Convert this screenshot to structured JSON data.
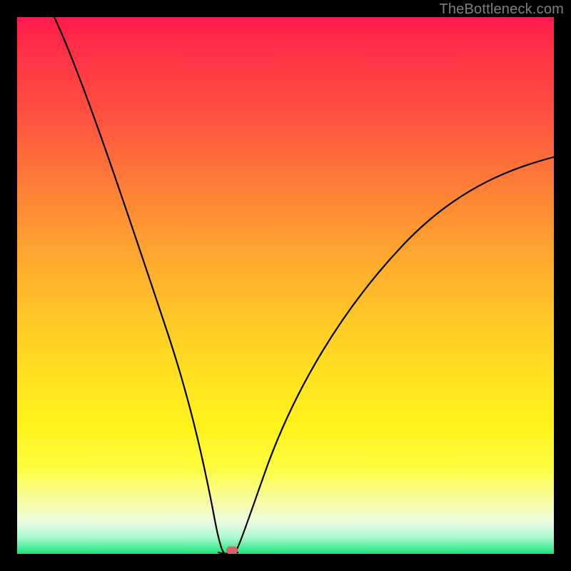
{
  "watermark": "TheBottleneck.com",
  "chart_data": {
    "type": "line",
    "title": "",
    "xlabel": "",
    "ylabel": "",
    "xlim": [
      0,
      100
    ],
    "ylim": [
      0,
      100
    ],
    "grid": false,
    "legend": false,
    "background_gradient": {
      "stops": [
        {
          "pos": 0,
          "color": "#ff1a4d"
        },
        {
          "pos": 7,
          "color": "#ff3346"
        },
        {
          "pos": 18,
          "color": "#ff5040"
        },
        {
          "pos": 30,
          "color": "#ff7a38"
        },
        {
          "pos": 42,
          "color": "#ffa030"
        },
        {
          "pos": 54,
          "color": "#ffc228"
        },
        {
          "pos": 66,
          "color": "#ffe020"
        },
        {
          "pos": 76,
          "color": "#fff21a"
        },
        {
          "pos": 84,
          "color": "#fdfd40"
        },
        {
          "pos": 90,
          "color": "#f8fca0"
        },
        {
          "pos": 94,
          "color": "#ecfce0"
        },
        {
          "pos": 97,
          "color": "#a8f9d0"
        },
        {
          "pos": 100,
          "color": "#19e47a"
        }
      ]
    },
    "series": [
      {
        "name": "left-branch",
        "x": [
          7,
          10,
          14,
          18,
          22,
          26,
          30,
          33,
          35,
          36.5,
          37.5
        ],
        "y": [
          100,
          88,
          74,
          60,
          47,
          34,
          22,
          12,
          5,
          1.5,
          0.2
        ]
      },
      {
        "name": "right-branch",
        "x": [
          40.5,
          42,
          45,
          49,
          54,
          60,
          67,
          75,
          84,
          93,
          100
        ],
        "y": [
          0.2,
          2,
          8,
          17,
          27,
          37,
          47,
          56,
          64,
          70,
          74
        ]
      },
      {
        "name": "valley-floor",
        "x": [
          37.5,
          38.5,
          39.5,
          40.5
        ],
        "y": [
          0.2,
          0,
          0,
          0.2
        ]
      }
    ],
    "marker": {
      "x": 40,
      "y": 0.6,
      "color": "#d9616a"
    }
  }
}
